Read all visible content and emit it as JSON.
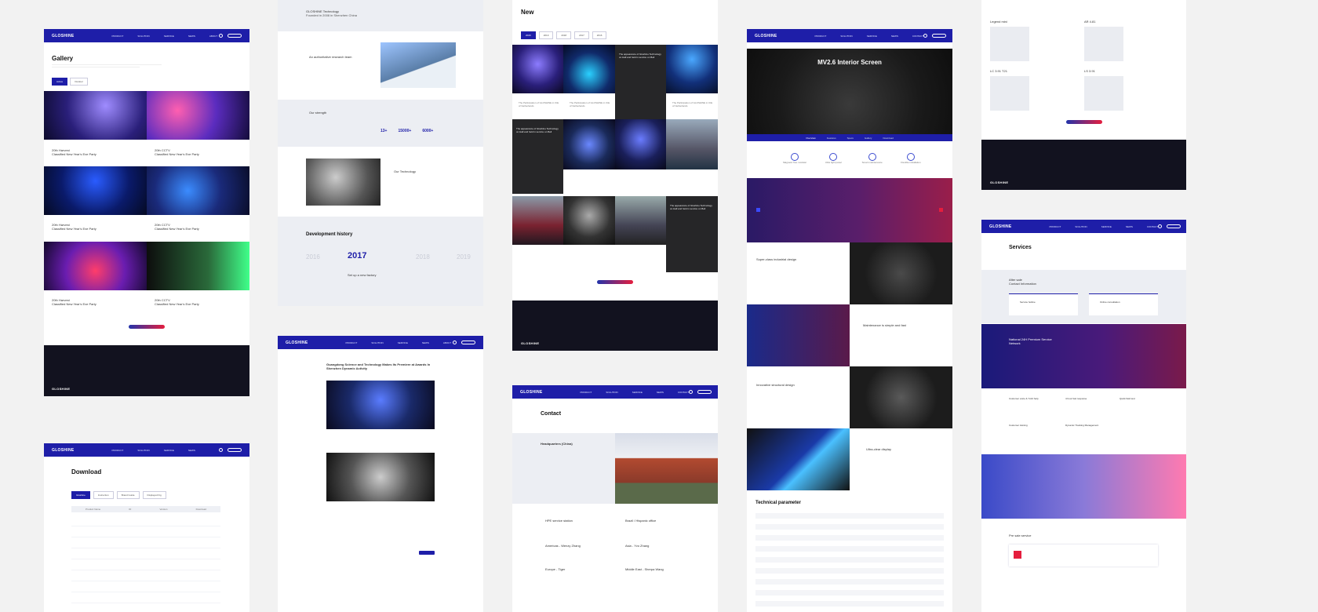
{
  "brand": {
    "logo": "GLOSHINE",
    "primary": "#1e1ea8",
    "accent": "#e51e3e"
  },
  "nav": [
    "PRODUCT",
    "SOLUTION",
    "SERVICE",
    "NEWS",
    "ABOUT",
    "CONTACT"
  ],
  "gallery": {
    "title": "Gallery",
    "tabs": [
      "Active",
      "Outdoor"
    ],
    "items": [
      {
        "name": "20th Harvest",
        "caption": "Classified New Year's Eve Party"
      },
      {
        "name": "20th CCTV",
        "caption": "Classified New Year's Eve Party"
      },
      {
        "name": "20th Harvest",
        "caption": "Classified New Year's Eve Party"
      },
      {
        "name": "20th CCTV",
        "caption": "Classified New Year's Eve Party"
      },
      {
        "name": "20th Harvest",
        "caption": "Classified New Year's Eve Party"
      },
      {
        "name": "20th CCTV",
        "caption": "Classified New Year's Eve Party"
      }
    ]
  },
  "download": {
    "title": "Download",
    "tabs": [
      "Gloshine",
      "Instruction",
      "Brand Guide",
      "Displayed Fig"
    ],
    "cols": [
      "Product Name",
      "ID",
      "Version",
      "Download"
    ]
  },
  "about": {
    "founded_head": "GLOSHINE Technology",
    "founded": "Founded in 2008 in Shenzhen China",
    "team": "An authoritative research team",
    "strength": "Our strength",
    "stats": [
      "13+",
      "15000+",
      "6000+"
    ],
    "technology": "Our Technology",
    "history": "Development history",
    "years": [
      "2016",
      "2017",
      "2018",
      "2019"
    ],
    "history_item": "Set up a new factory"
  },
  "article": {
    "title": "Guangdong Science and Technology Makes Its Premiere at Awards In Shenzhen Dynamic Activity"
  },
  "news": {
    "title": "New",
    "years": [
      "2020",
      "2019",
      "2018",
      "2017",
      "2016"
    ],
    "dark": [
      "The appearance of Gloshine Technology on Hall and held in service on Bell",
      "The appearance of Gloshine Technology on Hall and held in service on Bell",
      "The appearance of Gloshine Technology on Hall and held in service on Bell"
    ],
    "card": "The Participation of GLOSHINE in ICE of Netherlands"
  },
  "contact": {
    "title": "Contact",
    "hq": "Headquarters (China)",
    "offices": [
      "HPE service station",
      "Brazil / Hispanic office",
      "Americas - Wenzy Zhang",
      "Asia - Yvo Zhang",
      "Europe - Tiger",
      "Middle East - Sherpa Wang"
    ]
  },
  "product": {
    "title": "MV2.6 Interior Screen",
    "tabs": [
      "Overview",
      "Features",
      "Specs",
      "Gallery",
      "Download"
    ],
    "features": [
      "Magnetic free modular",
      "Ultra light panel",
      "Smart maintenance",
      "Flexible installation"
    ],
    "sections": [
      "Super-class industrial design",
      "Maintenance is simple and fast",
      "Innovative structural design",
      "Ultra-clear display"
    ],
    "spec_title": "Technical parameter"
  },
  "services": {
    "title": "Services",
    "after": "After sale",
    "contact_info": "Contact Information",
    "hotline": "Service hotline",
    "online": "Online consultation",
    "network": "National 24H Premium Service Network",
    "presale": "Pre sale service",
    "points": [
      "Customer voice & 7x24 help",
      "4 hour fast response",
      "Quick field test",
      "Customer training",
      "Dynamic Tracking Management"
    ]
  },
  "catalog": {
    "items": [
      "Legend mini",
      "AR 4.81",
      "LC 3.91 T21",
      "LS 3.91"
    ]
  }
}
